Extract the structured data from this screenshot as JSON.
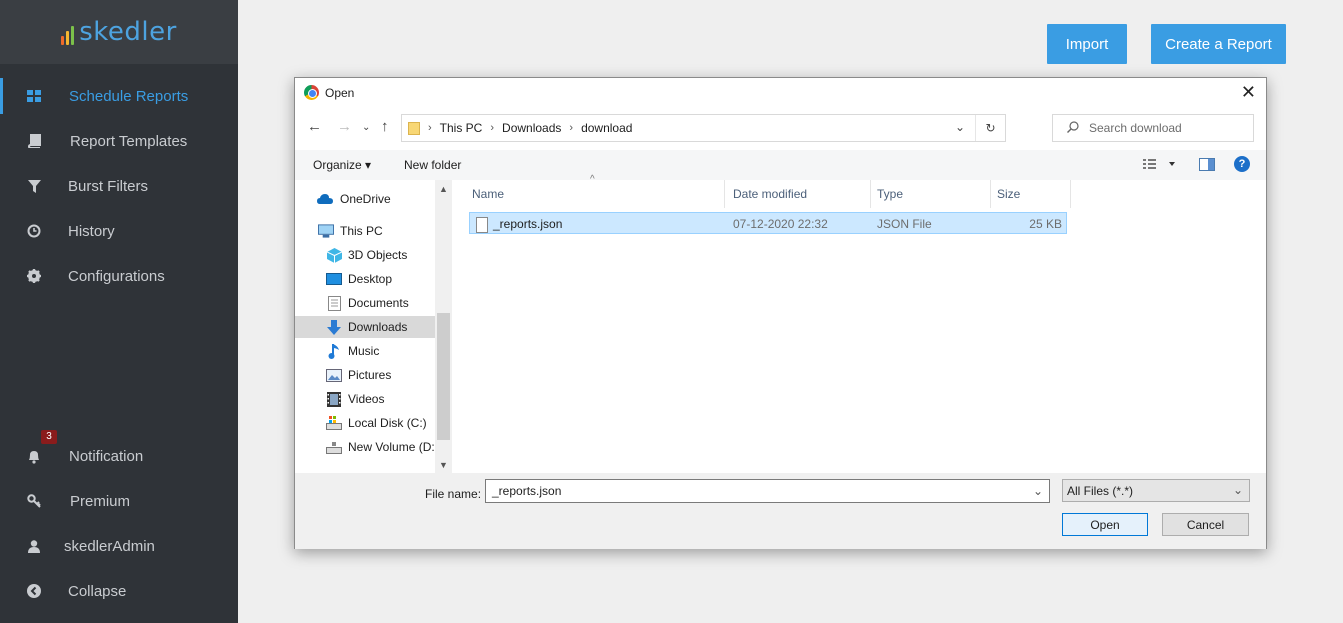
{
  "app": {
    "logo_text": "skedler",
    "logo_bar_colors": [
      "#ef6b2a",
      "#f5b731",
      "#7cc14a",
      "#4da3e0"
    ]
  },
  "sidebar": {
    "items": [
      {
        "label": "Schedule Reports",
        "icon": "grid-icon",
        "active": true
      },
      {
        "label": "Report Templates",
        "icon": "book-icon"
      },
      {
        "label": "Burst Filters",
        "icon": "filter-icon"
      },
      {
        "label": "History",
        "icon": "clock-icon"
      },
      {
        "label": "Configurations",
        "icon": "gear-icon"
      }
    ],
    "bottom_items": [
      {
        "label": "Notification",
        "icon": "bell-icon",
        "badge": "3"
      },
      {
        "label": "Premium",
        "icon": "key-icon"
      },
      {
        "label": "skedlerAdmin",
        "icon": "user-icon"
      },
      {
        "label": "Collapse",
        "icon": "chevron-left-circle-icon"
      }
    ]
  },
  "header": {
    "import_label": "Import",
    "create_label": "Create a Report",
    "accent": "#3a9de3"
  },
  "dialog": {
    "title": "Open",
    "breadcrumb": [
      "This PC",
      "Downloads",
      "download"
    ],
    "search_placeholder": "Search download",
    "toolbar": {
      "organize": "Organize",
      "new_folder": "New folder"
    },
    "tree": [
      {
        "label": "OneDrive",
        "icon": "cloud-icon"
      },
      {
        "label": "This PC",
        "icon": "computer-icon"
      },
      {
        "label": "3D Objects",
        "icon": "cube-icon"
      },
      {
        "label": "Desktop",
        "icon": "desktop-icon"
      },
      {
        "label": "Documents",
        "icon": "document-icon"
      },
      {
        "label": "Downloads",
        "icon": "download-arrow-icon",
        "selected": true
      },
      {
        "label": "Music",
        "icon": "music-note-icon"
      },
      {
        "label": "Pictures",
        "icon": "picture-icon"
      },
      {
        "label": "Videos",
        "icon": "film-icon"
      },
      {
        "label": "Local Disk (C:)",
        "icon": "disk-icon"
      },
      {
        "label": "New Volume (D:",
        "icon": "drive-icon"
      }
    ],
    "columns": {
      "name": "Name",
      "date": "Date modified",
      "type": "Type",
      "size": "Size"
    },
    "files": [
      {
        "name": "_reports.json",
        "date": "07-12-2020 22:32",
        "type": "JSON File",
        "size": "25 KB"
      }
    ],
    "file_name_label": "File name:",
    "file_name_value": "_reports.json",
    "filter_value": "All Files (*.*)",
    "open_label": "Open",
    "cancel_label": "Cancel"
  }
}
